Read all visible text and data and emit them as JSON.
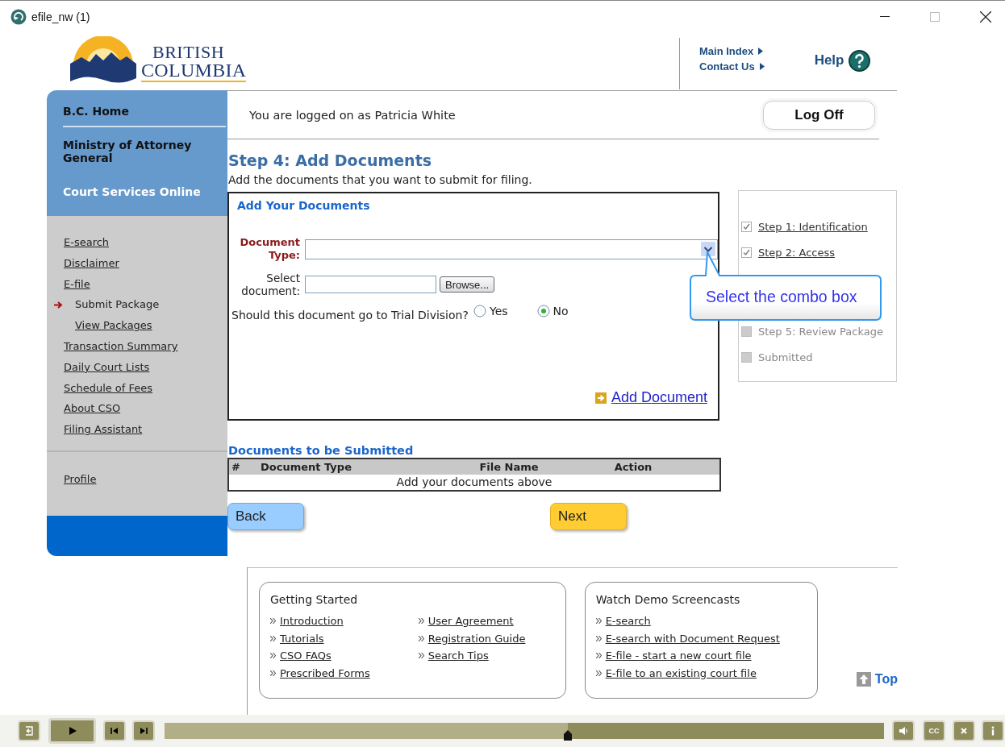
{
  "window": {
    "title": "efile_nw (1)"
  },
  "header": {
    "logo": {
      "line_1": "BRITISH",
      "line_2": "COLUMBIA"
    },
    "links": [
      {
        "label": "Main Index"
      },
      {
        "label": "Contact Us"
      }
    ],
    "help": "Help"
  },
  "sidebar": {
    "top_items": [
      {
        "label": "B.C. Home",
        "kind": "heading"
      },
      {
        "label": "Ministry of Attorney General",
        "kind": "heading"
      },
      {
        "label": "Court Services Online",
        "kind": "current"
      }
    ],
    "nav": [
      {
        "label": "E-search",
        "selected": false
      },
      {
        "label": "Disclaimer",
        "selected": false
      },
      {
        "label": "E-file",
        "selected": false,
        "children": [
          {
            "label": "Submit Package",
            "selected": true
          },
          {
            "label": "View Packages",
            "selected": false
          }
        ]
      },
      {
        "label": "Transaction Summary",
        "selected": false
      },
      {
        "label": "Daily Court Lists",
        "selected": false
      },
      {
        "label": "Schedule of Fees",
        "selected": false
      },
      {
        "label": "About CSO",
        "selected": false
      },
      {
        "label": "Filing Assistant",
        "selected": false
      }
    ],
    "bottom_nav": [
      {
        "label": "Profile",
        "selected": false
      }
    ]
  },
  "session": {
    "message": "You are logged on as Patricia White",
    "logoff": "Log Off"
  },
  "step": {
    "title": "Step 4: Add Documents",
    "description": "Add the documents that you want to submit for filing."
  },
  "add_form": {
    "title": "Add Your Documents",
    "document_type": {
      "label": "Document Type:"
    },
    "select_document": {
      "label": "Select document:",
      "button": "Browse..."
    },
    "trial_division": {
      "question": "Should this document go to Trial Division?",
      "options": [
        {
          "label": "Yes",
          "selected": false
        },
        {
          "label": "No",
          "selected": true
        }
      ]
    },
    "add_link": "Add Document"
  },
  "progress": {
    "steps": [
      {
        "label": "Step 1: Identification",
        "checked": true
      },
      {
        "label": "Step 2: Access",
        "checked": true
      },
      {
        "label": "Step 5: Review Package",
        "checked": false
      },
      {
        "label": "Submitted",
        "checked": false
      }
    ]
  },
  "callout": {
    "text": "Select the combo box"
  },
  "documents": {
    "title": "Documents to be Submitted",
    "columns": [
      "#",
      "Document Type",
      "File Name",
      "Action"
    ],
    "empty_message": "Add your documents above"
  },
  "nav_buttons": {
    "back": "Back",
    "next": "Next"
  },
  "footer": {
    "boxes": [
      {
        "title": "Getting Started",
        "links": [
          "Introduction",
          "Tutorials",
          "CSO FAQs",
          "Prescribed Forms",
          "User Agreement",
          "Registration Guide",
          "Search Tips"
        ]
      },
      {
        "title": "Watch Demo Screencasts",
        "links": [
          "E-search",
          "E-search with Document Request",
          "E-file - start a new court file",
          "E-file to an existing court file"
        ]
      }
    ],
    "top": "Top"
  },
  "player": {
    "level": 0.56,
    "captions_label": "CC"
  }
}
